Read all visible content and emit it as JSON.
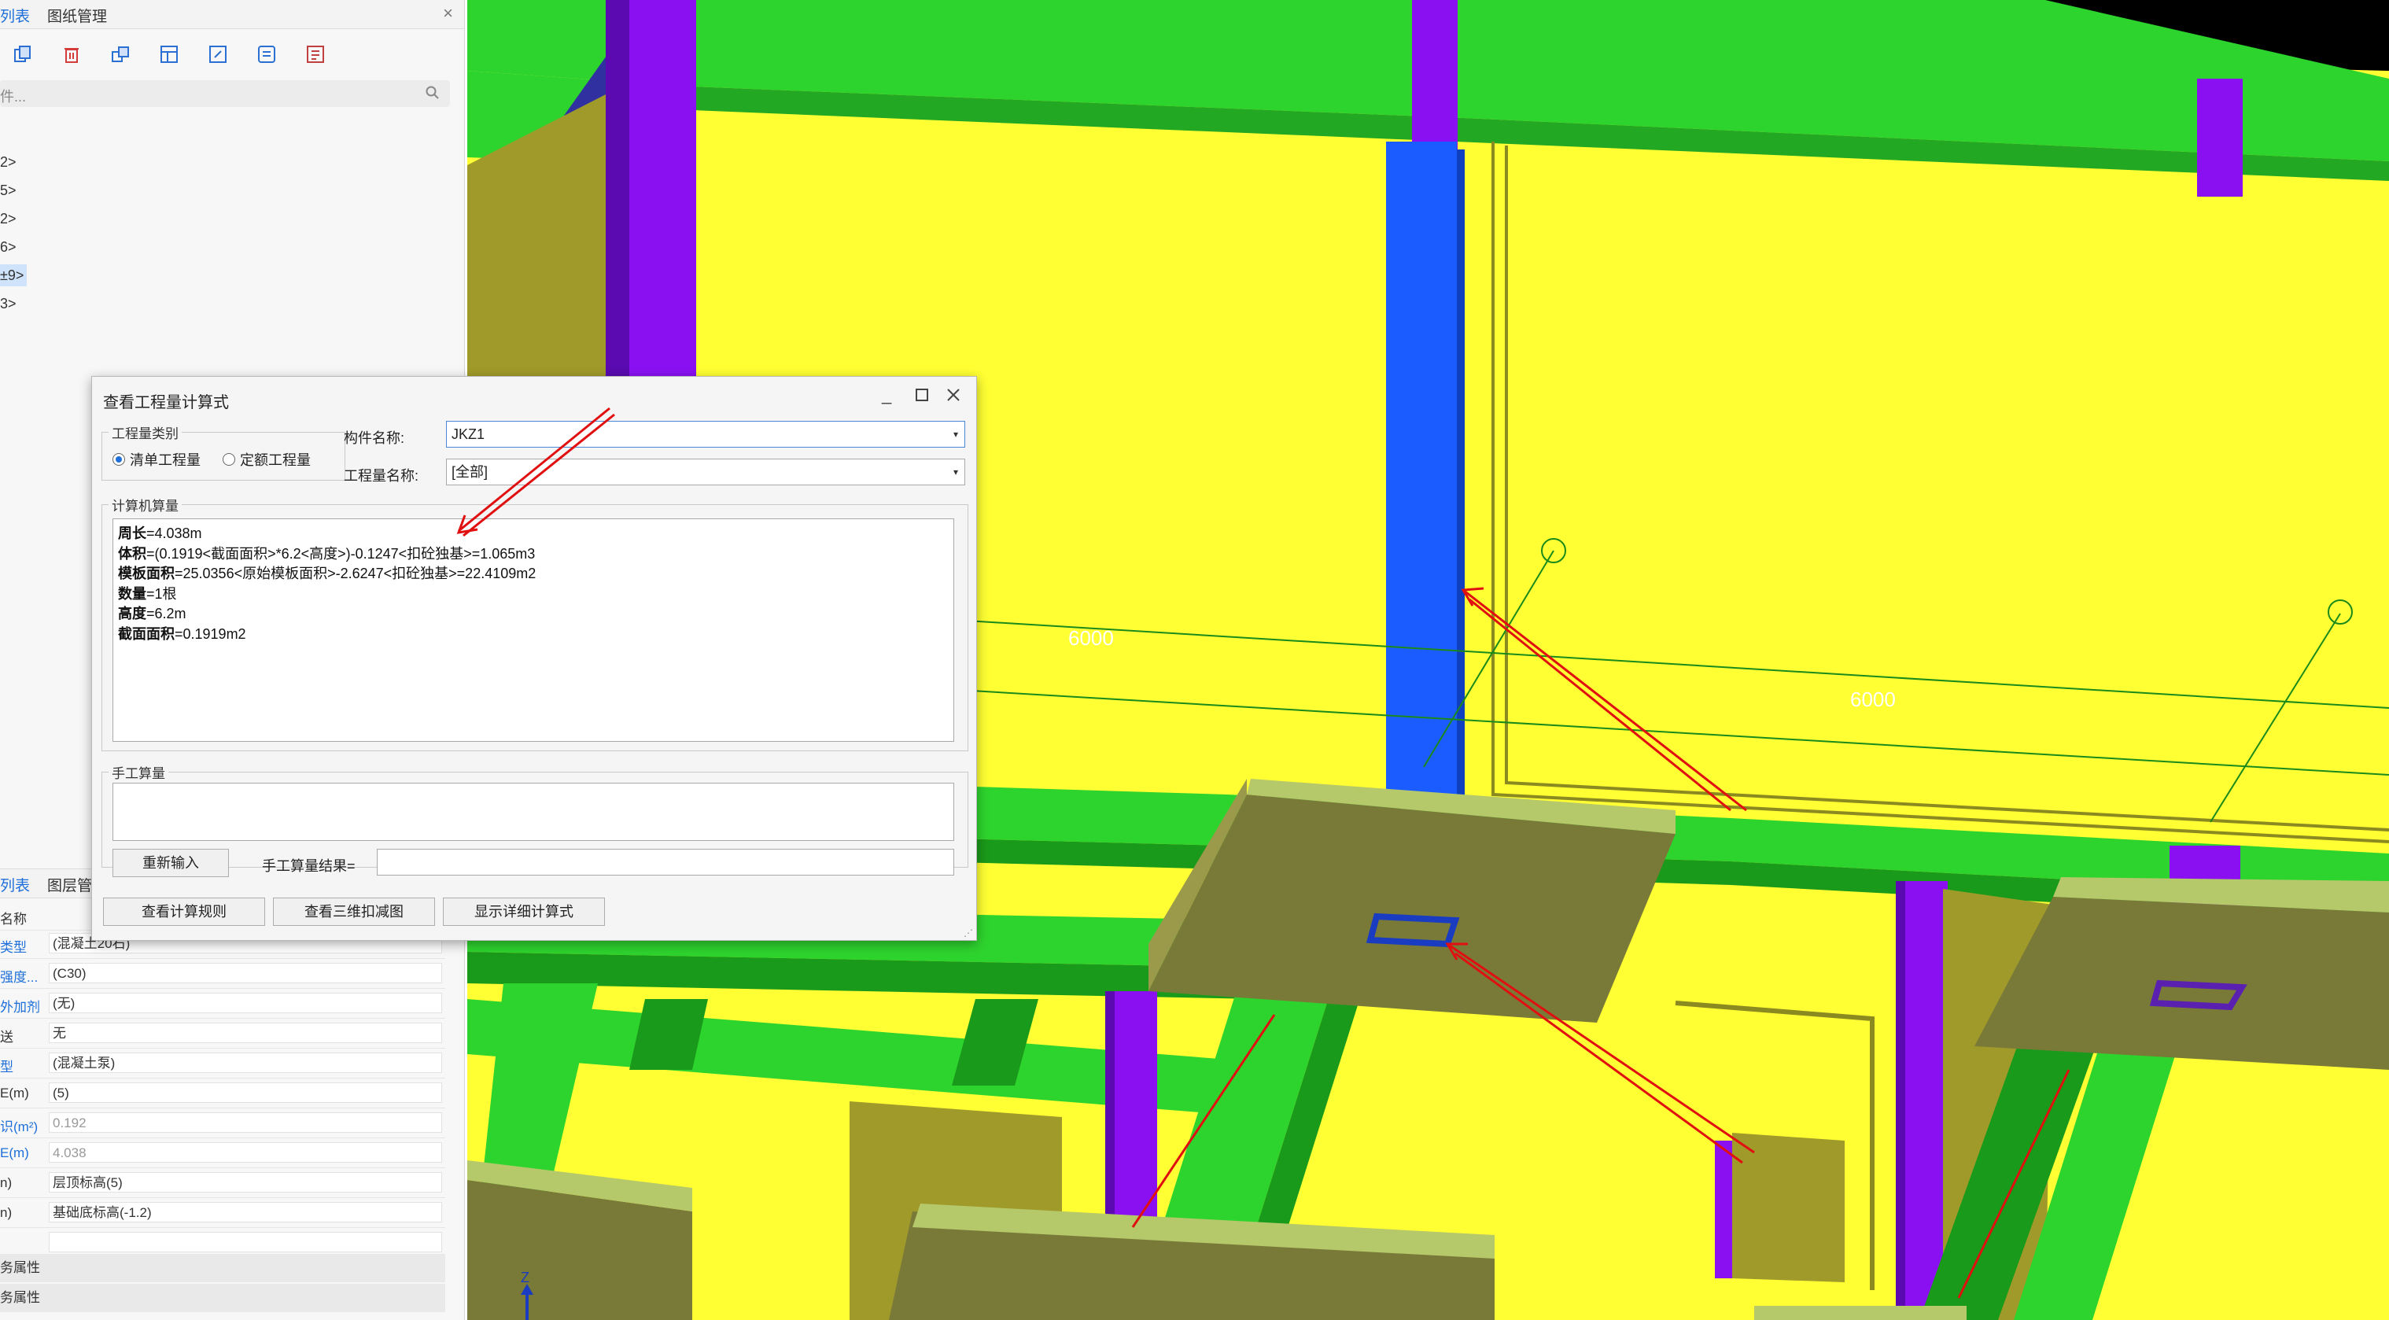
{
  "left_panel": {
    "top_tabs": [
      "列表",
      "图纸管理"
    ],
    "search_placeholder": "件...",
    "tree_items": [
      "2>",
      "5>",
      "2>",
      "6>",
      "±9>",
      "3>"
    ],
    "bottom_tabs": [
      "列表",
      "图层管"
    ],
    "properties": [
      {
        "name": "名称",
        "value": ""
      },
      {
        "name": "类型",
        "value": "(混凝土20石)"
      },
      {
        "name": "强度...",
        "value": "(C30)"
      },
      {
        "name": "外加剂",
        "value": "(无)"
      },
      {
        "name": "送",
        "value": "无"
      },
      {
        "name": "型",
        "value": "(混凝土泵)"
      },
      {
        "name": "E(m)",
        "value": "(5)"
      },
      {
        "name": "识(m²)",
        "value": "0.192"
      },
      {
        "name": "E(m)",
        "value": "4.038"
      },
      {
        "name": "n)",
        "value": "层顶标高(5)"
      },
      {
        "name": "n)",
        "value": "基础底标高(-1.2)"
      },
      {
        "name": "",
        "value": ""
      }
    ],
    "sections": [
      "务属性",
      "务属性"
    ]
  },
  "viewport": {
    "dimension_labels": [
      "6000",
      "6000"
    ],
    "axis_label": "Z"
  },
  "dialog": {
    "title": "查看工程量计算式",
    "category_group": "工程量类别",
    "radio_list": "清单工程量",
    "radio_quota": "定额工程量",
    "component_label": "构件名称:",
    "component_value": "JKZ1",
    "quantity_label": "工程量名称:",
    "quantity_value": "[全部]",
    "computer_group": "计算机算量",
    "calc_lines": [
      {
        "key": "周长",
        "rest": "=4.038m"
      },
      {
        "key": "体积",
        "rest": "=(0.1919<截面面积>*6.2<高度>)-0.1247<扣砼独基>=1.065m3"
      },
      {
        "key": "模板面积",
        "rest": "=25.0356<原始模板面积>-2.6247<扣砼独基>=22.4109m2"
      },
      {
        "key": "数量",
        "rest": "=1根"
      },
      {
        "key": "高度",
        "rest": "=6.2m"
      },
      {
        "key": "截面面积",
        "rest": "=0.1919m2"
      }
    ],
    "manual_group": "手工算量",
    "reenter_button": "重新输入",
    "manual_result_label": "手工算量结果=",
    "manual_result_value": "",
    "buttons": [
      "查看计算规则",
      "查看三维扣减图",
      "显示详细计算式"
    ]
  },
  "colors": {
    "wall_yellow": "#ffff33",
    "beam_green": "#2ed42e",
    "column_purple": "#8a10f2",
    "column_blue": "#1a5cff",
    "footing_olive": "#8f8f3a",
    "annotation_red": "#e01010"
  }
}
